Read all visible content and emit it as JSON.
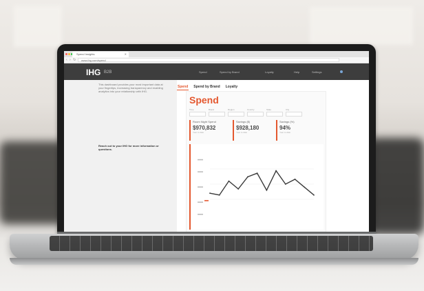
{
  "browser": {
    "tab_title": "Spend Insights",
    "url": "www.ihg.com/spend"
  },
  "header": {
    "logo": "IHG",
    "logo_sub": "B2B",
    "nav": [
      "Spend",
      "Spend by Brand",
      "Loyalty",
      "Help",
      "Settings"
    ]
  },
  "left_panel": {
    "intro": "This dashboard provides your most important data at your fingertips, increasing transparency and enabling analytics into your relationship with IHG.",
    "reach_out": "Reach out to your IHG for more information or questions."
  },
  "subtabs": [
    "Spend",
    "Spend by Brand",
    "Loyalty"
  ],
  "active_subtab": "Spend",
  "panel": {
    "title": "Spend",
    "filters": [
      {
        "label": "Time",
        "value": ""
      },
      {
        "label": "Brand",
        "value": ""
      },
      {
        "label": "Region",
        "value": ""
      },
      {
        "label": "Country",
        "value": ""
      },
      {
        "label": "State",
        "value": ""
      },
      {
        "label": "City",
        "value": ""
      }
    ],
    "kpis": [
      {
        "label": "Room Night Spend",
        "value": "$970,832",
        "sub": "Year to date"
      },
      {
        "label": "Savings ($)",
        "value": "$928,180",
        "sub": "Year to date"
      },
      {
        "label": "Savings (%)",
        "value": "94%",
        "sub": "Year to date"
      }
    ]
  },
  "chart_data": {
    "type": "line",
    "x": [
      1,
      2,
      3,
      4,
      5,
      6,
      7,
      8,
      9,
      10,
      11,
      12
    ],
    "values": [
      35,
      32,
      55,
      42,
      62,
      68,
      40,
      72,
      50,
      58,
      45,
      32
    ],
    "ylim": [
      0,
      100
    ],
    "accent": "#e4572e",
    "line_color": "#3a3a3a"
  },
  "colors": {
    "accent": "#e4572e",
    "header_bg": "#3d3d3d"
  }
}
